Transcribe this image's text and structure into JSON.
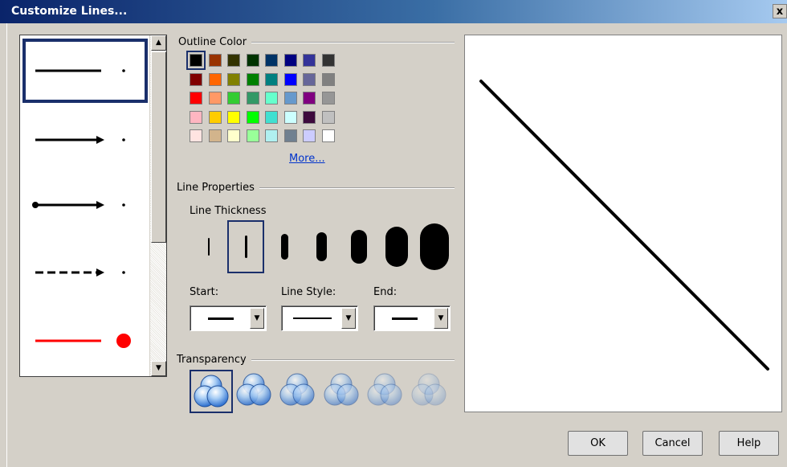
{
  "window": {
    "title": "Customize Lines...",
    "close_glyph": "x"
  },
  "line_presets": [
    {
      "style": "solid",
      "start": "none",
      "end": "none",
      "color": "#000000",
      "tail": "small-dot",
      "selected": true
    },
    {
      "style": "solid",
      "start": "none",
      "end": "arrow",
      "color": "#000000",
      "tail": "small-dot",
      "selected": false
    },
    {
      "style": "solid",
      "start": "dot",
      "end": "arrow",
      "color": "#000000",
      "tail": "small-dot",
      "selected": false
    },
    {
      "style": "dashed",
      "start": "none",
      "end": "arrow",
      "color": "#000000",
      "tail": "small-dot",
      "selected": false
    },
    {
      "style": "solid",
      "start": "none",
      "end": "none",
      "color": "#ff0000",
      "tail": "large-dot",
      "selected": false
    }
  ],
  "outline_color": {
    "heading": "Outline Color",
    "more_label": "More...",
    "selected_color": "#000000",
    "rows": [
      [
        "#000000",
        "#993300",
        "#333300",
        "#003300",
        "#003366",
        "#000080",
        "#333399",
        "#333333"
      ],
      [
        "#800000",
        "#ff6600",
        "#808000",
        "#008000",
        "#008080",
        "#0000ff",
        "#666699",
        "#808080"
      ],
      [
        "#ff0000",
        "#ff9966",
        "#33cc33",
        "#339966",
        "#66ffcc",
        "#6699cc",
        "#800080",
        "#969696"
      ],
      [
        "#ffb6c1",
        "#ffcc00",
        "#ffff00",
        "#00ff00",
        "#40e0d0",
        "#ccffff",
        "#3d0a3d",
        "#c0c0c0"
      ],
      [
        "#ffe4e1",
        "#d2b48c",
        "#ffffcc",
        "#99ff99",
        "#b0f0f0",
        "#708090",
        "#ccccff",
        "#ffffff"
      ]
    ]
  },
  "line_properties": {
    "heading": "Line Properties",
    "thickness_label": "Line Thickness",
    "selected_thickness": 1,
    "start_label": "Start:",
    "style_label": "Line Style:",
    "end_label": "End:"
  },
  "transparency": {
    "heading": "Transparency",
    "levels": [
      1.0,
      0.85,
      0.7,
      0.55,
      0.4,
      0.25
    ],
    "selected": 0
  },
  "buttons": {
    "ok": "OK",
    "cancel": "Cancel",
    "help": "Help"
  },
  "icons": {
    "scroll_up": "scroll-up-arrow",
    "scroll_down": "scroll-down-arrow",
    "dropdown": "dropdown-arrow"
  }
}
